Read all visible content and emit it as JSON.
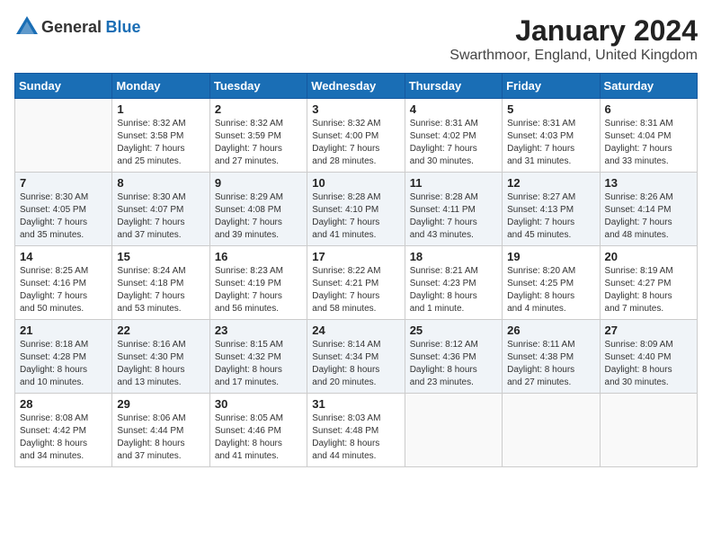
{
  "header": {
    "logo_general": "General",
    "logo_blue": "Blue",
    "month_title": "January 2024",
    "subtitle": "Swarthmoor, England, United Kingdom"
  },
  "days_of_week": [
    "Sunday",
    "Monday",
    "Tuesday",
    "Wednesday",
    "Thursday",
    "Friday",
    "Saturday"
  ],
  "weeks": [
    [
      {
        "date": "",
        "info": ""
      },
      {
        "date": "1",
        "info": "Sunrise: 8:32 AM\nSunset: 3:58 PM\nDaylight: 7 hours\nand 25 minutes."
      },
      {
        "date": "2",
        "info": "Sunrise: 8:32 AM\nSunset: 3:59 PM\nDaylight: 7 hours\nand 27 minutes."
      },
      {
        "date": "3",
        "info": "Sunrise: 8:32 AM\nSunset: 4:00 PM\nDaylight: 7 hours\nand 28 minutes."
      },
      {
        "date": "4",
        "info": "Sunrise: 8:31 AM\nSunset: 4:02 PM\nDaylight: 7 hours\nand 30 minutes."
      },
      {
        "date": "5",
        "info": "Sunrise: 8:31 AM\nSunset: 4:03 PM\nDaylight: 7 hours\nand 31 minutes."
      },
      {
        "date": "6",
        "info": "Sunrise: 8:31 AM\nSunset: 4:04 PM\nDaylight: 7 hours\nand 33 minutes."
      }
    ],
    [
      {
        "date": "7",
        "info": "Sunrise: 8:30 AM\nSunset: 4:05 PM\nDaylight: 7 hours\nand 35 minutes."
      },
      {
        "date": "8",
        "info": "Sunrise: 8:30 AM\nSunset: 4:07 PM\nDaylight: 7 hours\nand 37 minutes."
      },
      {
        "date": "9",
        "info": "Sunrise: 8:29 AM\nSunset: 4:08 PM\nDaylight: 7 hours\nand 39 minutes."
      },
      {
        "date": "10",
        "info": "Sunrise: 8:28 AM\nSunset: 4:10 PM\nDaylight: 7 hours\nand 41 minutes."
      },
      {
        "date": "11",
        "info": "Sunrise: 8:28 AM\nSunset: 4:11 PM\nDaylight: 7 hours\nand 43 minutes."
      },
      {
        "date": "12",
        "info": "Sunrise: 8:27 AM\nSunset: 4:13 PM\nDaylight: 7 hours\nand 45 minutes."
      },
      {
        "date": "13",
        "info": "Sunrise: 8:26 AM\nSunset: 4:14 PM\nDaylight: 7 hours\nand 48 minutes."
      }
    ],
    [
      {
        "date": "14",
        "info": "Sunrise: 8:25 AM\nSunset: 4:16 PM\nDaylight: 7 hours\nand 50 minutes."
      },
      {
        "date": "15",
        "info": "Sunrise: 8:24 AM\nSunset: 4:18 PM\nDaylight: 7 hours\nand 53 minutes."
      },
      {
        "date": "16",
        "info": "Sunrise: 8:23 AM\nSunset: 4:19 PM\nDaylight: 7 hours\nand 56 minutes."
      },
      {
        "date": "17",
        "info": "Sunrise: 8:22 AM\nSunset: 4:21 PM\nDaylight: 7 hours\nand 58 minutes."
      },
      {
        "date": "18",
        "info": "Sunrise: 8:21 AM\nSunset: 4:23 PM\nDaylight: 8 hours\nand 1 minute."
      },
      {
        "date": "19",
        "info": "Sunrise: 8:20 AM\nSunset: 4:25 PM\nDaylight: 8 hours\nand 4 minutes."
      },
      {
        "date": "20",
        "info": "Sunrise: 8:19 AM\nSunset: 4:27 PM\nDaylight: 8 hours\nand 7 minutes."
      }
    ],
    [
      {
        "date": "21",
        "info": "Sunrise: 8:18 AM\nSunset: 4:28 PM\nDaylight: 8 hours\nand 10 minutes."
      },
      {
        "date": "22",
        "info": "Sunrise: 8:16 AM\nSunset: 4:30 PM\nDaylight: 8 hours\nand 13 minutes."
      },
      {
        "date": "23",
        "info": "Sunrise: 8:15 AM\nSunset: 4:32 PM\nDaylight: 8 hours\nand 17 minutes."
      },
      {
        "date": "24",
        "info": "Sunrise: 8:14 AM\nSunset: 4:34 PM\nDaylight: 8 hours\nand 20 minutes."
      },
      {
        "date": "25",
        "info": "Sunrise: 8:12 AM\nSunset: 4:36 PM\nDaylight: 8 hours\nand 23 minutes."
      },
      {
        "date": "26",
        "info": "Sunrise: 8:11 AM\nSunset: 4:38 PM\nDaylight: 8 hours\nand 27 minutes."
      },
      {
        "date": "27",
        "info": "Sunrise: 8:09 AM\nSunset: 4:40 PM\nDaylight: 8 hours\nand 30 minutes."
      }
    ],
    [
      {
        "date": "28",
        "info": "Sunrise: 8:08 AM\nSunset: 4:42 PM\nDaylight: 8 hours\nand 34 minutes."
      },
      {
        "date": "29",
        "info": "Sunrise: 8:06 AM\nSunset: 4:44 PM\nDaylight: 8 hours\nand 37 minutes."
      },
      {
        "date": "30",
        "info": "Sunrise: 8:05 AM\nSunset: 4:46 PM\nDaylight: 8 hours\nand 41 minutes."
      },
      {
        "date": "31",
        "info": "Sunrise: 8:03 AM\nSunset: 4:48 PM\nDaylight: 8 hours\nand 44 minutes."
      },
      {
        "date": "",
        "info": ""
      },
      {
        "date": "",
        "info": ""
      },
      {
        "date": "",
        "info": ""
      }
    ]
  ]
}
